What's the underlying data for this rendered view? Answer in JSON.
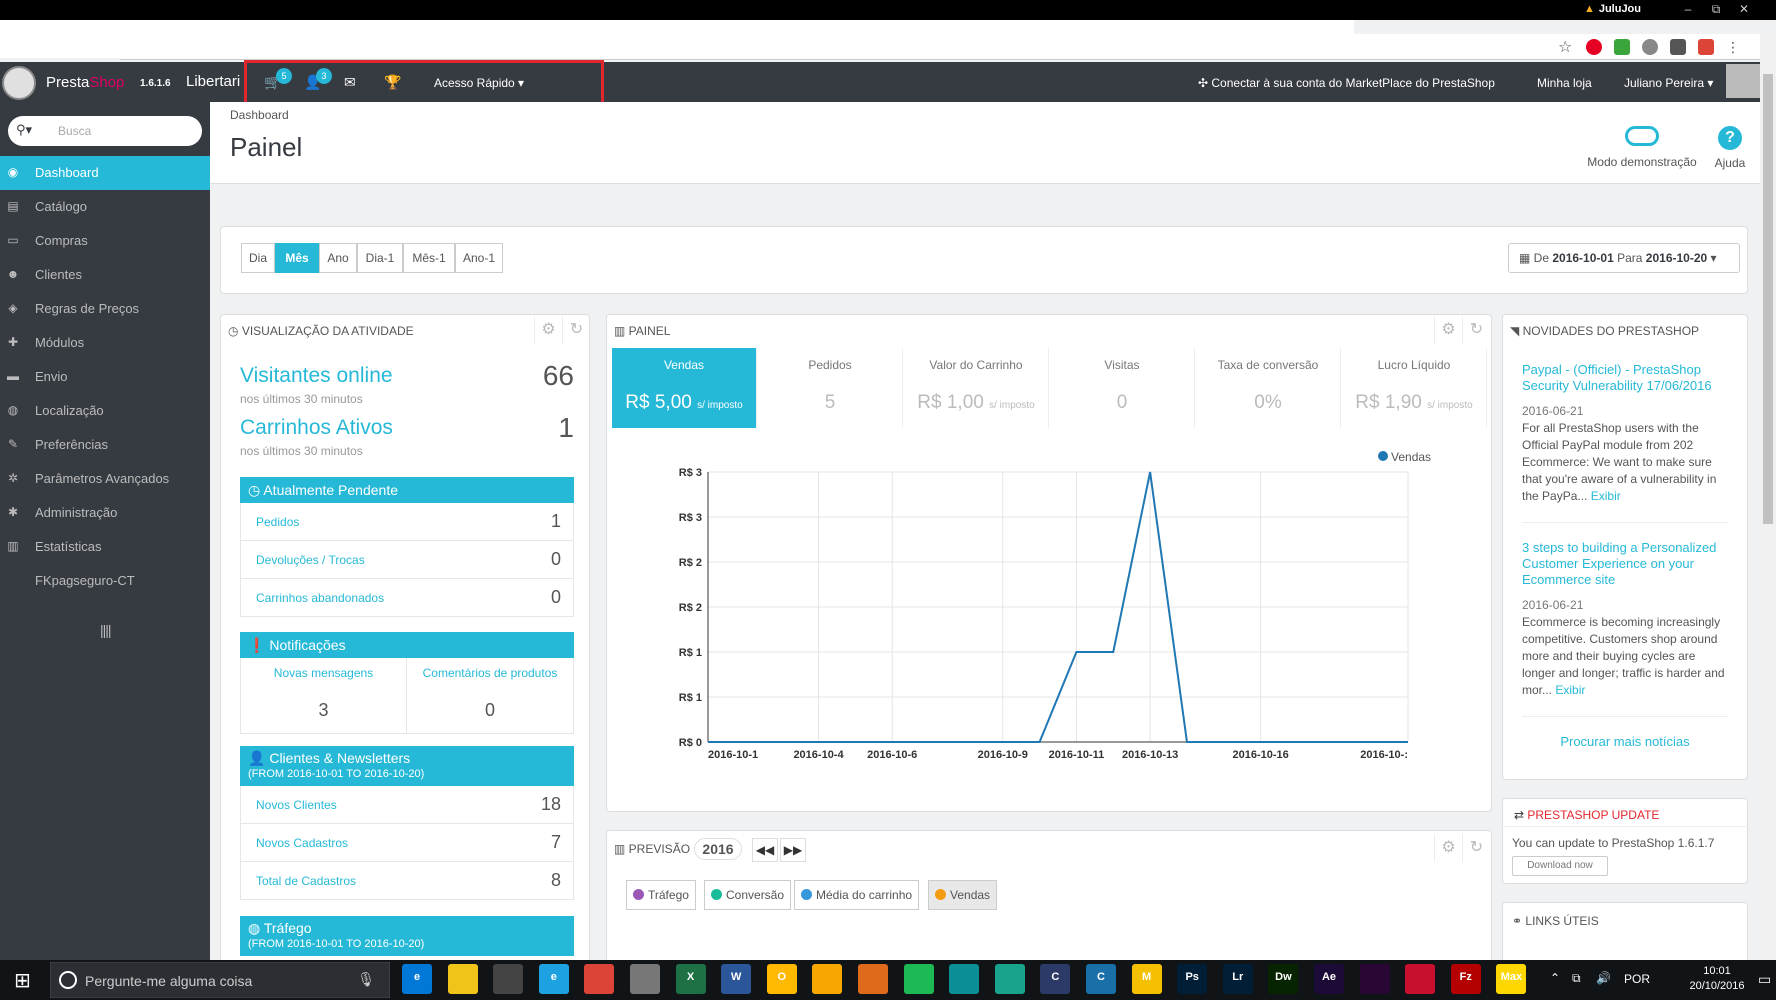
{
  "browser": {
    "window_title": "JuluJou",
    "window_buttons": [
      "–",
      "⧉",
      "✕"
    ],
    "bookmark_star": "☆"
  },
  "header": {
    "logo_presta": "Presta",
    "logo_shop": "Shop",
    "version": "1.6.1.6",
    "shop_name": "Libertari",
    "orders_badge": "5",
    "customers_badge": "3",
    "quick_access": "Acesso Rápido ▾",
    "marketplace": "Conectar à sua conta do MarketPlace do PrestaShop",
    "my_shop": "Minha loja",
    "user": "Juliano Pereira ▾"
  },
  "search": {
    "placeholder": "Busca"
  },
  "sidebar": {
    "items": [
      {
        "label": "Dashboard",
        "icon": "dashboard-icon",
        "glyph": "◉"
      },
      {
        "label": "Catálogo",
        "icon": "book-icon",
        "glyph": "▤"
      },
      {
        "label": "Compras",
        "icon": "credit-card-icon",
        "glyph": "▭"
      },
      {
        "label": "Clientes",
        "icon": "users-icon",
        "glyph": "☻"
      },
      {
        "label": "Regras de Preços",
        "icon": "tags-icon",
        "glyph": "◈"
      },
      {
        "label": "Módulos",
        "icon": "puzzle-icon",
        "glyph": "✚"
      },
      {
        "label": "Envio",
        "icon": "truck-icon",
        "glyph": "▬"
      },
      {
        "label": "Localização",
        "icon": "globe-icon",
        "glyph": "◍"
      },
      {
        "label": "Preferências",
        "icon": "wrench-icon",
        "glyph": "✎"
      },
      {
        "label": "Parâmetros Avançados",
        "icon": "cogs-icon",
        "glyph": "✲"
      },
      {
        "label": "Administração",
        "icon": "cog-icon",
        "glyph": "✱"
      },
      {
        "label": "Estatísticas",
        "icon": "bar-chart-icon",
        "glyph": "▥"
      },
      {
        "label": "FKpagseguro-CT",
        "icon": "",
        "glyph": ""
      }
    ],
    "collapse": "||||"
  },
  "page": {
    "breadcrumb": "Dashboard",
    "title": "Painel",
    "demo_mode": "Modo demonstração",
    "help": "Ajuda"
  },
  "periods": {
    "buttons": [
      "Dia",
      "Mês",
      "Ano",
      "Dia-1",
      "Mês-1",
      "Ano-1"
    ],
    "active": "Mês",
    "date_prefix": "De",
    "date_from": "2016-10-01",
    "date_mid": "Para",
    "date_to": "2016-10-20"
  },
  "activity": {
    "title": "Visualização da atividade",
    "visitors_label": "Visitantes online",
    "visitors_value": "66",
    "visitors_sub": "nos últimos 30 minutos",
    "carts_label": "Carrinhos Ativos",
    "carts_value": "1",
    "carts_sub": "nos últimos 30 minutos",
    "pending_title": "Atualmente Pendente",
    "pending": [
      {
        "label": "Pedidos",
        "value": "1"
      },
      {
        "label": "Devoluções / Trocas",
        "value": "0"
      },
      {
        "label": "Carrinhos abandonados",
        "value": "0"
      }
    ],
    "notif_title": "Notificações",
    "notif_messages_label": "Novas mensagens",
    "notif_messages_value": "3",
    "notif_comments_label": "Comentários de produtos",
    "notif_comments_value": "0",
    "clients_title": "Clientes & Newsletters",
    "clients_range": "(FROM 2016-10-01 TO 2016-10-20)",
    "clients": [
      {
        "label": "Novos Clientes",
        "value": "18"
      },
      {
        "label": "Novos Cadastros",
        "value": "7"
      },
      {
        "label": "Total de Cadastros",
        "value": "8"
      }
    ],
    "traffic_title": "Tráfego",
    "traffic_range": "(FROM 2016-10-01 TO 2016-10-20)"
  },
  "painel": {
    "title": "Painel",
    "kpis": [
      {
        "label": "Vendas",
        "value": "R$ 5,00",
        "suffix": "s/ imposto"
      },
      {
        "label": "Pedidos",
        "value": "5",
        "suffix": ""
      },
      {
        "label": "Valor do Carrinho",
        "value": "R$ 1,00",
        "suffix": "s/ imposto"
      },
      {
        "label": "Visitas",
        "value": "0",
        "suffix": ""
      },
      {
        "label": "Taxa de conversão",
        "value": "0%",
        "suffix": ""
      },
      {
        "label": "Lucro Líquido",
        "value": "R$ 1,90",
        "suffix": "s/ imposto"
      }
    ]
  },
  "chart_data": {
    "type": "line",
    "title": "",
    "xlabel": "",
    "ylabel": "",
    "series": [
      {
        "name": "Vendas",
        "color": "#1f77b4",
        "values": [
          0,
          0,
          0,
          0,
          0,
          0,
          0,
          0,
          0,
          0,
          1,
          1,
          3,
          0,
          0,
          0,
          0,
          0,
          0,
          0
        ]
      }
    ],
    "x": [
      "2016-10-01",
      "2016-10-02",
      "2016-10-03",
      "2016-10-04",
      "2016-10-05",
      "2016-10-06",
      "2016-10-07",
      "2016-10-08",
      "2016-10-09",
      "2016-10-10",
      "2016-10-11",
      "2016-10-12",
      "2016-10-13",
      "2016-10-14",
      "2016-10-15",
      "2016-10-16",
      "2016-10-17",
      "2016-10-18",
      "2016-10-19",
      "2016-10-20"
    ],
    "x_tick_labels": [
      "2016-10-1",
      "2016-10-4",
      "2016-10-6",
      "2016-10-9",
      "2016-10-11",
      "2016-10-13",
      "2016-10-16",
      "2016-10-:"
    ],
    "y_tick_labels": [
      "R$ 3",
      "R$ 3",
      "R$ 2",
      "R$ 2",
      "R$ 1",
      "R$ 1",
      "R$ 0"
    ],
    "ylim": [
      0,
      3
    ],
    "legend": "top-right",
    "grid": true
  },
  "previsao": {
    "title": "Previsão",
    "year": "2016",
    "legend": [
      {
        "label": "Tráfego",
        "color": "#9b59b6"
      },
      {
        "label": "Conversão",
        "color": "#1abc9c"
      },
      {
        "label": "Média do carrinho",
        "color": "#3498db"
      },
      {
        "label": "Vendas",
        "color": "#f39c12"
      }
    ]
  },
  "news": {
    "title": "Novidades do PrestaShop",
    "items": [
      {
        "title": "Paypal - (Officiel) - PrestaShop Security Vulnerability 17/06/2016",
        "date": "2016-06-21",
        "body": "For all PrestaShop users with the Official PayPal module from 202 Ecommerce: We want to make sure that you're aware of a vulnerability in the PayPa...",
        "more": "Exibir"
      },
      {
        "title": "3 steps to building a Personalized Customer Experience on your Ecommerce site",
        "date": "2016-06-21",
        "body": "Ecommerce is becoming increasingly competitive. Customers shop around more and their buying cycles are longer and longer; traffic is harder and mor...",
        "more": "Exibir"
      }
    ],
    "more_link": "Procurar mais notícias"
  },
  "update": {
    "title": "PrestaShop Update",
    "text": "You can update to PrestaShop 1.6.1.7",
    "button": "Download now"
  },
  "links": {
    "title": "Links úteis"
  },
  "taskbar": {
    "search_placeholder": "Pergunte-me alguma coisa",
    "apps": [
      {
        "name": "edge-icon",
        "color": "#0078d7",
        "label": "e"
      },
      {
        "name": "explorer-icon",
        "color": "#f0c419",
        "label": ""
      },
      {
        "name": "store-icon",
        "color": "#444",
        "label": ""
      },
      {
        "name": "ie-icon",
        "color": "#1ea1e0",
        "label": "e"
      },
      {
        "name": "chrome-icon",
        "color": "#db4437",
        "label": ""
      },
      {
        "name": "app-icon",
        "color": "#777",
        "label": ""
      },
      {
        "name": "excel-icon",
        "color": "#1e7145",
        "label": "X"
      },
      {
        "name": "word-icon",
        "color": "#2b579a",
        "label": "W"
      },
      {
        "name": "outlook-icon",
        "color": "#ffb900",
        "label": "O"
      },
      {
        "name": "app-icon",
        "color": "#f7a800",
        "label": ""
      },
      {
        "name": "app-icon",
        "color": "#e06a1b",
        "label": ""
      },
      {
        "name": "spotify-icon",
        "color": "#1db954",
        "label": ""
      },
      {
        "name": "maya-icon",
        "color": "#0b8e96",
        "label": ""
      },
      {
        "name": "maya-icon",
        "color": "#17a38e",
        "label": ""
      },
      {
        "name": "cinema4d-icon",
        "color": "#2b3a67",
        "label": "C"
      },
      {
        "name": "app-icon",
        "color": "#1b6fa8",
        "label": "C"
      },
      {
        "name": "app-icon",
        "color": "#f5c000",
        "label": "M"
      },
      {
        "name": "photoshop-icon",
        "color": "#001e36",
        "label": "Ps"
      },
      {
        "name": "lightroom-icon",
        "color": "#001e36",
        "label": "Lr"
      },
      {
        "name": "dreamweaver-icon",
        "color": "#072401",
        "label": "Dw"
      },
      {
        "name": "aftereffects-icon",
        "color": "#1c0b37",
        "label": "Ae"
      },
      {
        "name": "premiere-icon",
        "color": "#2a0634",
        "label": ""
      },
      {
        "name": "app-icon",
        "color": "#c8102e",
        "label": ""
      },
      {
        "name": "filezilla-icon",
        "color": "#b40000",
        "label": "Fz"
      },
      {
        "name": "max-icon",
        "color": "#ffd700",
        "label": "Max"
      }
    ],
    "lang": "POR",
    "time": "10:01",
    "date": "20/10/2016"
  }
}
